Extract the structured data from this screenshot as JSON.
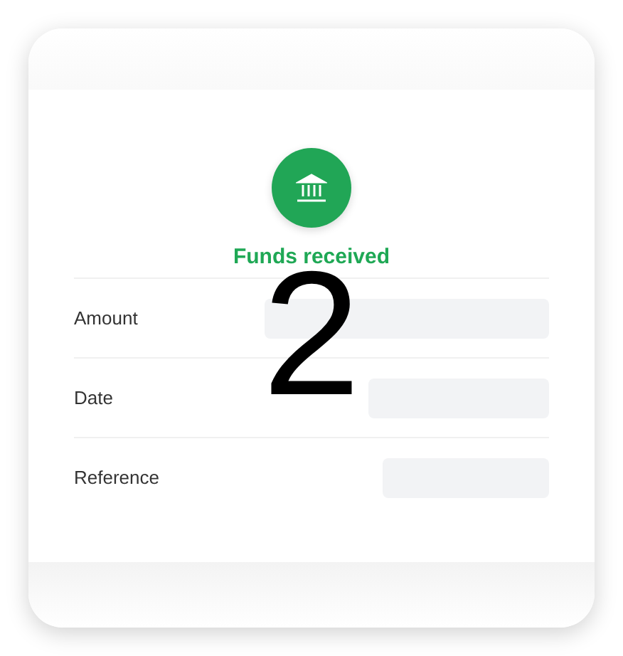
{
  "status": {
    "title": "Funds received"
  },
  "details": [
    {
      "label": "Amount"
    },
    {
      "label": "Date"
    },
    {
      "label": "Reference"
    }
  ],
  "step_number": "2"
}
